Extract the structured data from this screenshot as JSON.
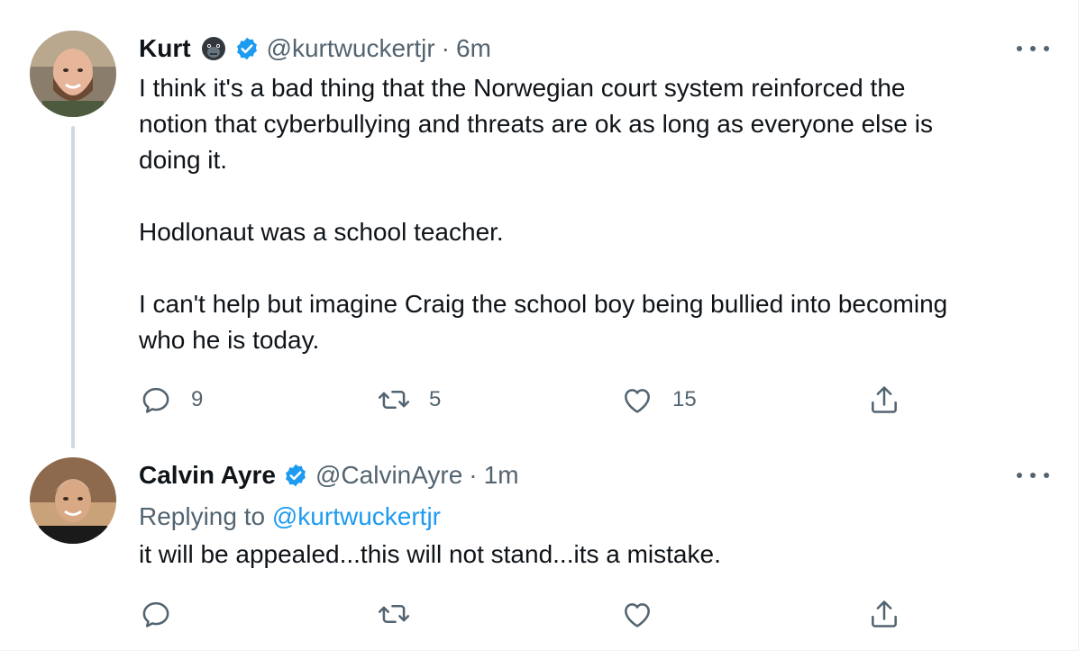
{
  "tweets": [
    {
      "name": "Kurt",
      "emoji": "gorilla-emoji",
      "verified": true,
      "handle": "@kurtwuckertjr",
      "separator": "·",
      "time": "6m",
      "paragraphs": [
        "I think it's a bad thing that the Norwegian court system reinforced the",
        "notion that cyberbullying and threats are ok as long as everyone else is",
        "doing it.",
        "",
        "Hodlonaut was a school teacher.",
        "",
        "I can't help but imagine Craig the school boy being bullied into becoming",
        "who he is today."
      ],
      "actions": {
        "replies": "9",
        "retweets": "5",
        "likes": "15"
      }
    },
    {
      "name": "Calvin Ayre",
      "verified": true,
      "handle": "@CalvinAyre",
      "separator": "·",
      "time": "1m",
      "replying_prefix": "Replying to",
      "replying_to": "@kurtwuckertjr",
      "text": "it will be appealed...this will not stand...its a mistake.",
      "actions": {
        "replies": "",
        "retweets": "",
        "likes": ""
      }
    }
  ],
  "colors": {
    "text": "#0f1419",
    "secondary": "#536471",
    "accent": "#1d9bf0",
    "thread_line": "#cfd9de"
  },
  "icons": [
    "more-icon",
    "verified-badge-icon",
    "reply-icon",
    "retweet-icon",
    "like-icon",
    "share-icon"
  ]
}
